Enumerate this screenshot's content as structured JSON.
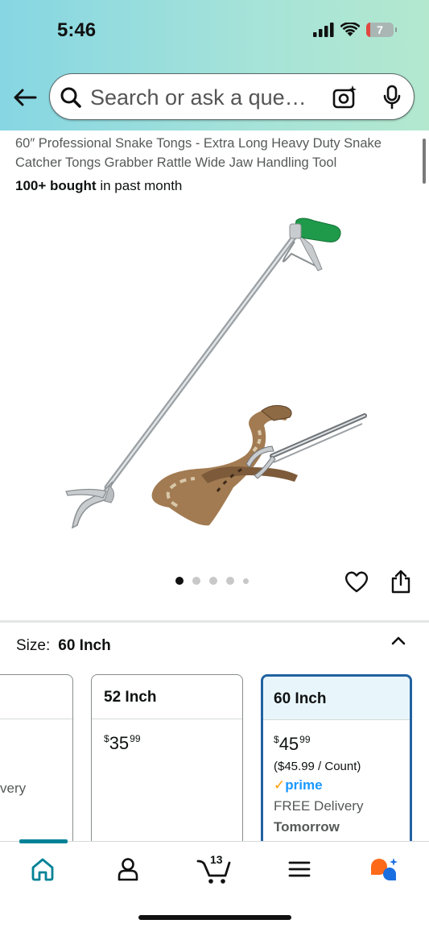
{
  "status_bar": {
    "time": "5:46",
    "battery_level": "7",
    "icons": [
      "cellular-signal-icon",
      "wifi-icon",
      "battery-icon"
    ]
  },
  "search": {
    "placeholder": "Search or ask a que…",
    "icons": [
      "back-arrow-icon",
      "search-icon",
      "camera-sparkle-icon",
      "microphone-icon"
    ]
  },
  "product": {
    "title": "60″ Professional Snake Tongs - Extra Long Heavy Duty Snake Catcher Tongs Grabber Rattle Wide Jaw Handling Tool",
    "bought_bold": "100+ bought",
    "bought_rest": " in past month",
    "image_dots": {
      "total": 5,
      "active_index": 0
    },
    "action_icons": [
      "heart-icon",
      "share-icon"
    ]
  },
  "size_selector": {
    "label": "Size:",
    "selected": "60 Inch",
    "options": [
      {
        "name": "",
        "price_whole": "",
        "price_fraction": "",
        "partial_text": "very"
      },
      {
        "name": "52 Inch",
        "currency": "$",
        "price_whole": "35",
        "price_fraction": "99"
      },
      {
        "name": "60 Inch",
        "currency": "$",
        "price_whole": "45",
        "price_fraction": "99",
        "unit_price": "($45.99 / Count)",
        "prime_check": "✓",
        "prime": "prime",
        "delivery": "FREE Delivery",
        "delivery_day": "Tomorrow"
      }
    ]
  },
  "tab_bar": {
    "cart_count": "13",
    "tabs": [
      "home",
      "account",
      "cart",
      "menu",
      "rufus-ai"
    ]
  },
  "colors": {
    "accent_teal": "#008296",
    "selected_border": "#2162a1",
    "prime_blue": "#1a98ff",
    "header_gradient_start": "#86d6e3",
    "header_gradient_end": "#b3e8cf",
    "handle_green": "#1e9a4a"
  }
}
